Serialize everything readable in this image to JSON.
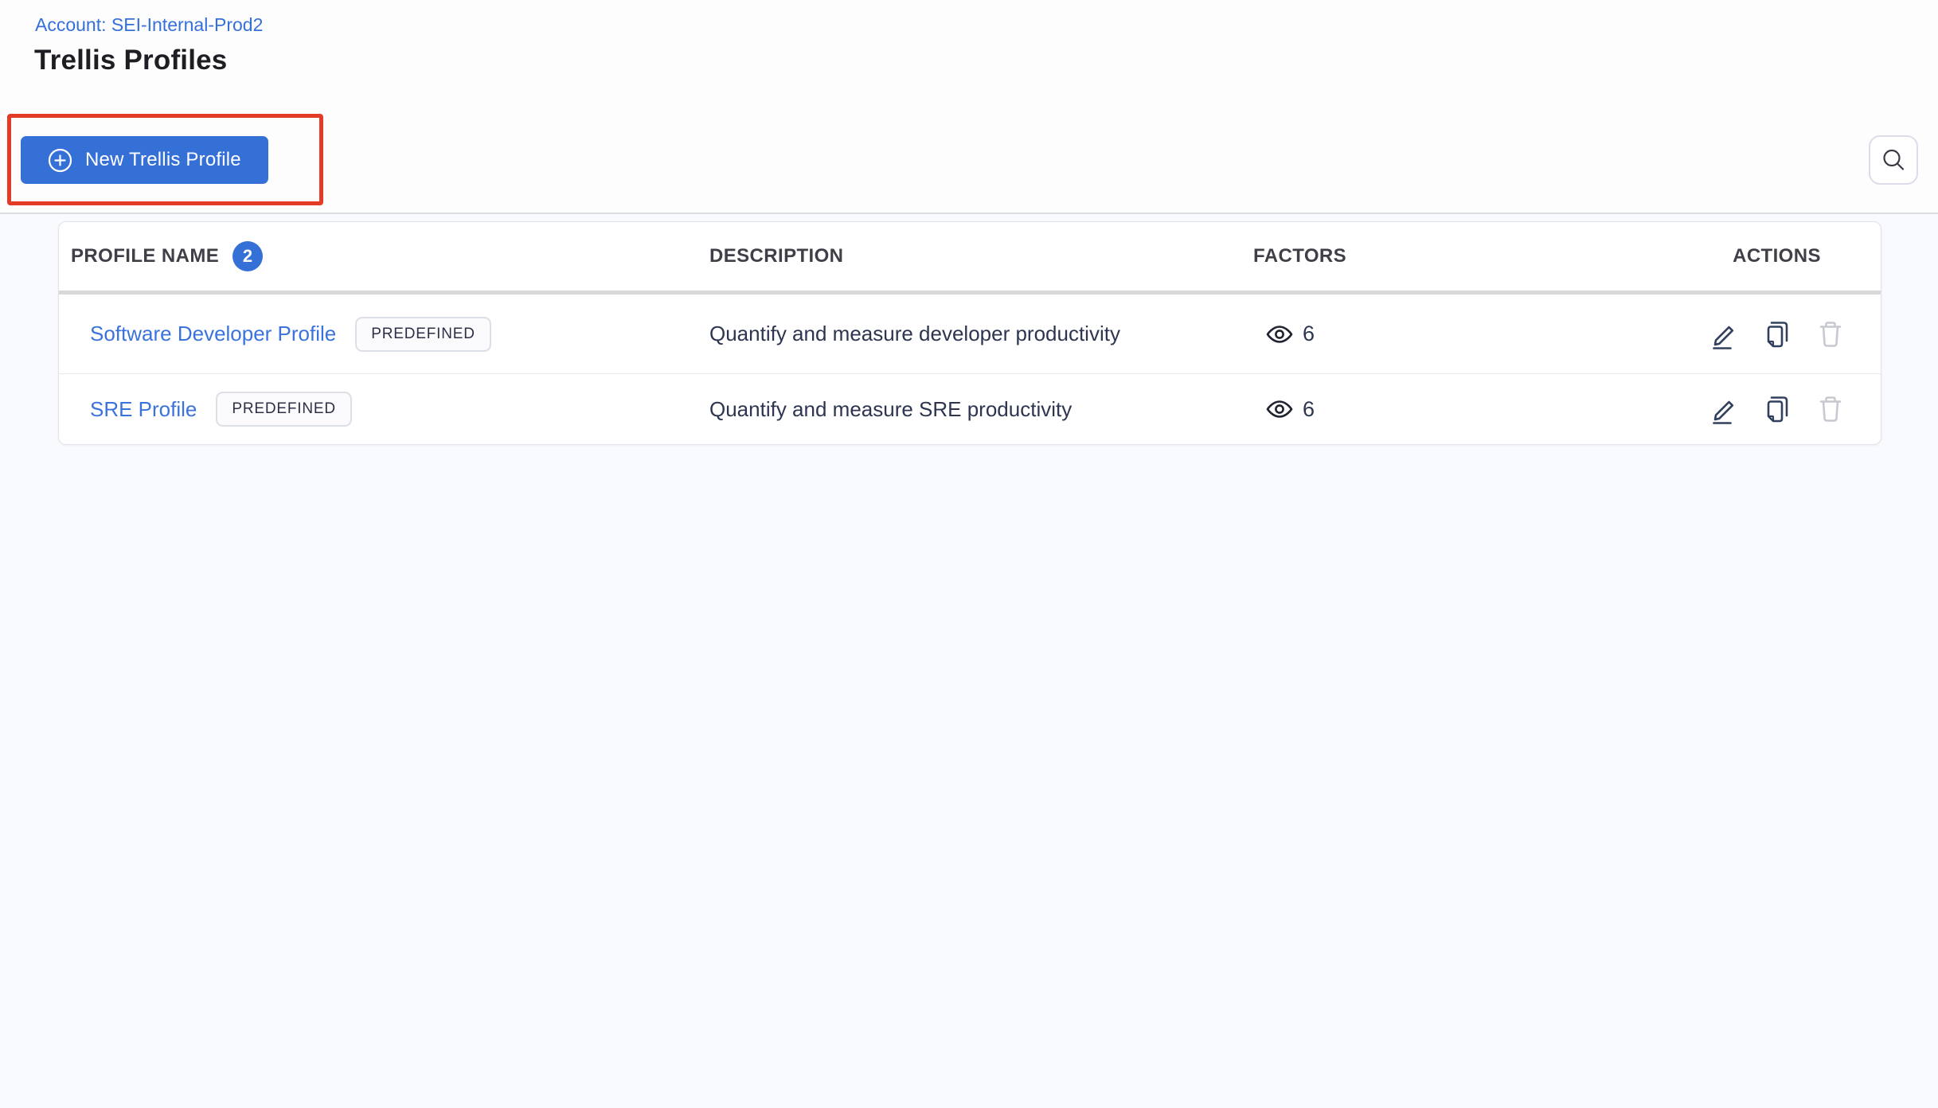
{
  "page": {
    "breadcrumb": "Account: SEI-Internal-Prod2",
    "title": "Trellis Profiles"
  },
  "toolbar": {
    "new_profile_label": "New Trellis Profile",
    "icons": {
      "plus": "plus-circle-icon",
      "search": "search-icon"
    }
  },
  "table": {
    "headers": {
      "profile_name": "PROFILE NAME",
      "count": "2",
      "description": "DESCRIPTION",
      "factors": "FACTORS",
      "actions": "ACTIONS"
    },
    "row_icons": {
      "factors": "eye-icon",
      "edit": "pencil-icon",
      "clone": "copy-icon",
      "delete": "trash-icon"
    },
    "rows": [
      {
        "name": "Software Developer Profile",
        "tag": "PREDEFINED",
        "description": "Quantify and measure developer productivity",
        "factors": "6"
      },
      {
        "name": "SRE Profile",
        "tag": "PREDEFINED",
        "description": "Quantify and measure SRE productivity",
        "factors": "6"
      }
    ]
  },
  "colors": {
    "accent_blue": "#3570d6",
    "link_blue": "#3a73dc",
    "annotation_red": "#e33b26",
    "icon_navy": "#31405f",
    "disabled_gray": "#c7c9d1"
  }
}
